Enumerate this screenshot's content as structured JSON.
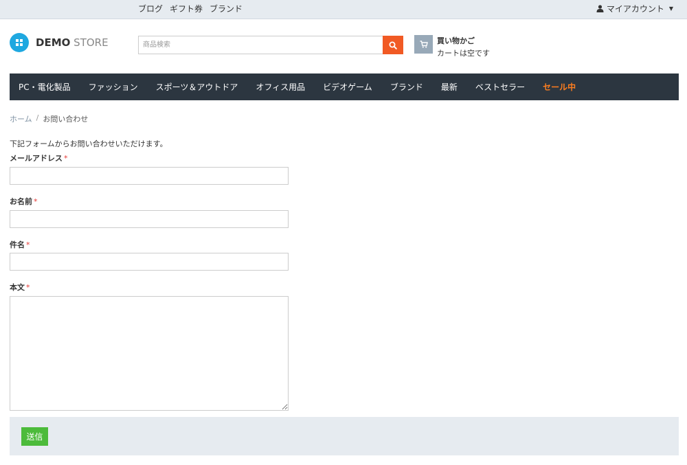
{
  "topbar": {
    "links": [
      "ブログ",
      "ギフト券",
      "ブランド"
    ],
    "account_label": "マイアカウント"
  },
  "header": {
    "logo_bold": "DEMO",
    "logo_light": "STORE",
    "search_placeholder": "商品検索",
    "cart_title": "買い物かご",
    "cart_status": "カートは空です"
  },
  "nav": {
    "items": [
      "PC・電化製品",
      "ファッション",
      "スポーツ＆アウトドア",
      "オフィス用品",
      "ビデオゲーム",
      "ブランド",
      "最新",
      "ベストセラー"
    ],
    "sale_label": "セール中"
  },
  "breadcrumb": {
    "home": "ホーム",
    "separator": "/",
    "current": "お問い合わせ"
  },
  "form": {
    "intro": "下記フォームからお問い合わせいただけます。",
    "required_mark": "*",
    "email_label": "メールアドレス",
    "name_label": "お名前",
    "subject_label": "件名",
    "body_label": "本文",
    "submit_label": "送信"
  },
  "colors": {
    "accent": "#f15a24",
    "nav_bg": "#2c3640",
    "sale": "#ff7e1f",
    "submit": "#4cbb3b",
    "required": "#e53935"
  }
}
